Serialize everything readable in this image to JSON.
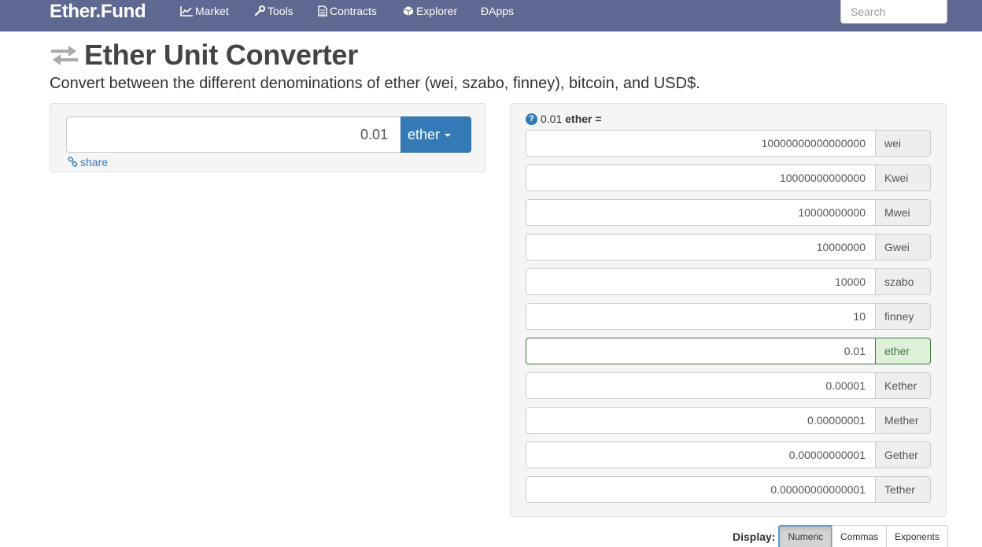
{
  "navbar": {
    "brand": "Ether.Fund",
    "items": [
      {
        "label": "Market",
        "icon": "chart-line-icon"
      },
      {
        "label": "Tools",
        "icon": "wrench-icon"
      },
      {
        "label": "Contracts",
        "icon": "document-icon"
      },
      {
        "label": "Explorer",
        "icon": "cube-icon"
      },
      {
        "label": "ÐApps",
        "icon": ""
      }
    ],
    "search_placeholder": "Search"
  },
  "header": {
    "title": "Ether Unit Converter",
    "subtitle": "Convert between the different denominations of ether (wei, szabo, finney), bitcoin, and USD$."
  },
  "converter": {
    "input_value": "0.01",
    "unit_label": "ether",
    "share_label": "share"
  },
  "results": {
    "heading_value": "0.01",
    "heading_unit": "ether =",
    "rows": [
      {
        "value": "10000000000000000",
        "unit": "wei"
      },
      {
        "value": "10000000000000",
        "unit": "Kwei"
      },
      {
        "value": "10000000000",
        "unit": "Mwei"
      },
      {
        "value": "10000000",
        "unit": "Gwei"
      },
      {
        "value": "10000",
        "unit": "szabo"
      },
      {
        "value": "10",
        "unit": "finney"
      },
      {
        "value": "0.01",
        "unit": "ether",
        "active": true
      },
      {
        "value": "0.00001",
        "unit": "Kether"
      },
      {
        "value": "0.00000001",
        "unit": "Mether"
      },
      {
        "value": "0.00000000001",
        "unit": "Gether"
      },
      {
        "value": "0.00000000000001",
        "unit": "Tether"
      }
    ]
  },
  "display": {
    "label": "Display:",
    "options": [
      "Numeric",
      "Commas",
      "Exponents"
    ],
    "selected": "Numeric"
  },
  "colors": {
    "navbar": "#5f6891",
    "primary": "#337ab7",
    "active_green": "#3c763d",
    "active_green_bg": "#dff0d8"
  }
}
